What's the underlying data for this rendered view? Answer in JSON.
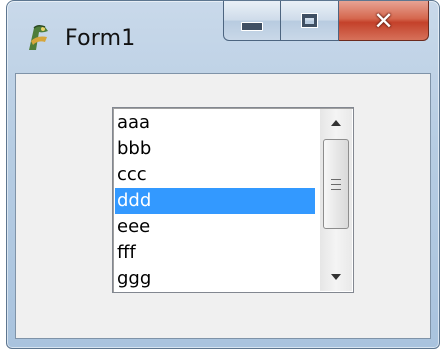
{
  "window": {
    "title": "Form1"
  },
  "caption_buttons": {
    "minimize": "minimize-icon",
    "maximize": "maximize-icon",
    "close": "close-icon"
  },
  "listbox": {
    "items": [
      "aaa",
      "bbb",
      "ccc",
      "ddd",
      "eee",
      "fff",
      "ggg"
    ],
    "selected_index": 3
  },
  "colors": {
    "selection": "#3399ff",
    "close_button": "#c4412a"
  }
}
